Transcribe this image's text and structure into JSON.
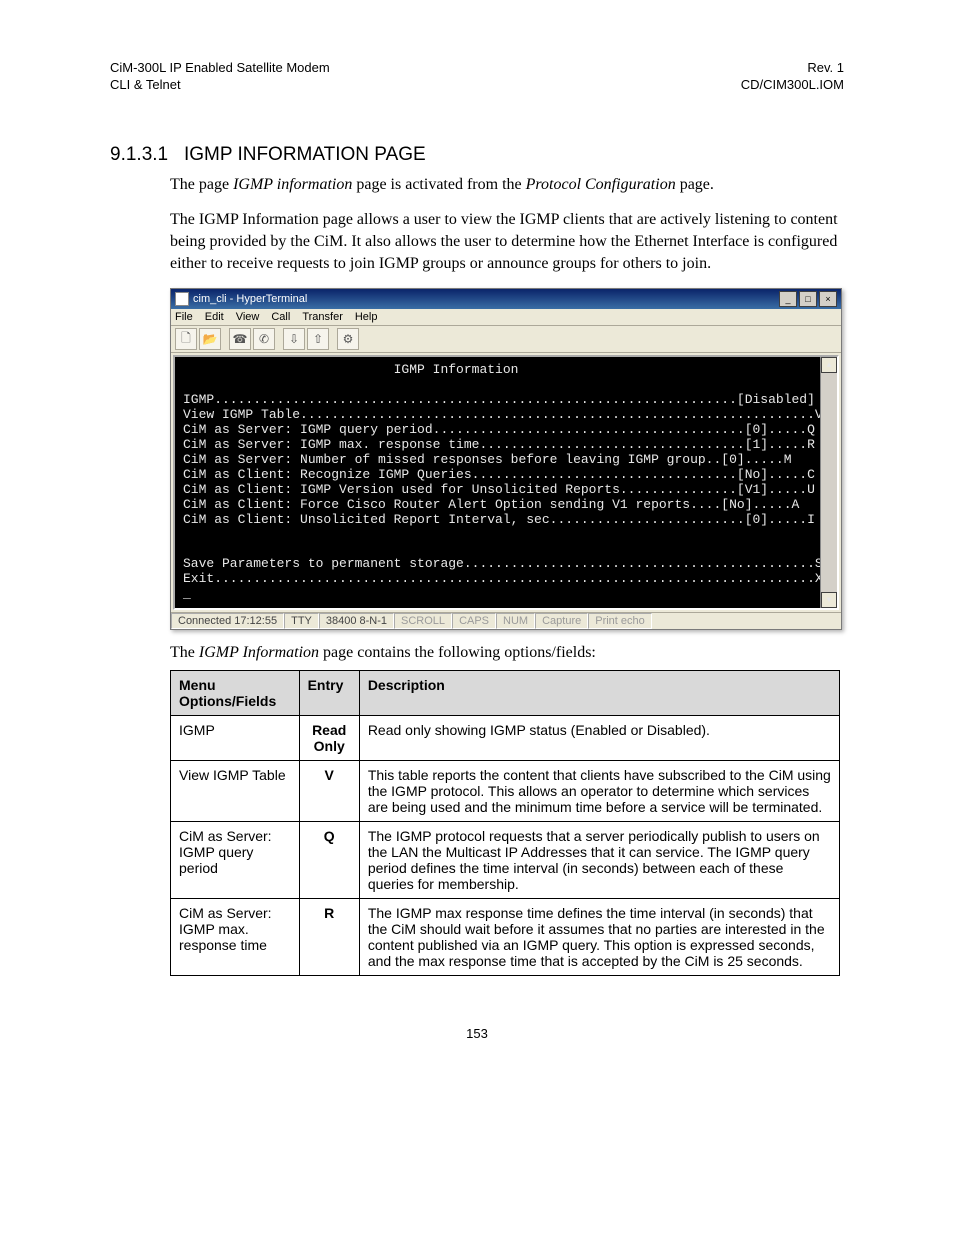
{
  "header": {
    "left1": "CiM-300L IP Enabled Satellite Modem",
    "left2": "CLI & Telnet",
    "right1": "Rev. 1",
    "right2": "CD/CIM300L.IOM"
  },
  "section": {
    "number": "9.1.3.1",
    "title": "IGMP INFORMATION PAGE"
  },
  "para1_pre": "The page ",
  "para1_em1": "IGMP information",
  "para1_mid": " page is activated from the ",
  "para1_em2": "Protocol Configuration",
  "para1_post": " page.",
  "para2": "The IGMP Information page allows a user to view the IGMP clients that are actively listening to content being provided by the CiM. It also allows the user to determine how the Ethernet Interface is configured either to receive requests to join IGMP groups or announce groups for others to join.",
  "ht": {
    "title": "cim_cli - HyperTerminal",
    "menu": [
      "File",
      "Edit",
      "View",
      "Call",
      "Transfer",
      "Help"
    ],
    "term_heading": "IGMP Information",
    "lines": [
      "IGMP...................................................................[Disabled]",
      "View IGMP Table..................................................................V",
      "CiM as Server: IGMP query period........................................[0].....Q",
      "CiM as Server: IGMP max. response time..................................[1].....R",
      "CiM as Server: Number of missed responses before leaving IGMP group..[0].....M",
      "CiM as Client: Recognize IGMP Queries..................................[No].....C",
      "CiM as Client: IGMP Version used for Unsolicited Reports...............[V1].....U",
      "CiM as Client: Force Cisco Router Alert Option sending V1 reports....[No].....A",
      "CiM as Client: Unsolicited Report Interval, sec.........................[0].....I",
      "",
      "",
      "Save Parameters to permanent storage.............................................S",
      "Exit.............................................................................X",
      "_"
    ],
    "status": {
      "connected": "Connected 17:12:55",
      "mode": "TTY",
      "settings": "38400 8-N-1",
      "flags": [
        "SCROLL",
        "CAPS",
        "NUM",
        "Capture",
        "Print echo"
      ]
    }
  },
  "caption_pre": "The ",
  "caption_em": "IGMP Information",
  "caption_post": " page contains the following options/fields:",
  "table": {
    "headers": [
      "Menu Options/Fields",
      "Entry",
      "Description"
    ],
    "rows": [
      {
        "opt": "IGMP",
        "entry": "Read Only",
        "desc": "Read only showing IGMP status (Enabled or Disabled)."
      },
      {
        "opt": "View IGMP Table",
        "entry": "V",
        "desc": "This table reports the content that clients have subscribed to the CiM using the IGMP protocol. This allows an operator to determine which services are being used and the minimum time before a service will be terminated."
      },
      {
        "opt": "CiM as Server:\nIGMP query period",
        "entry": "Q",
        "desc": "The IGMP protocol requests that a server periodically publish to users on the LAN the Multicast IP Addresses that it can service. The IGMP query period defines the time interval (in seconds) between each of these queries for membership."
      },
      {
        "opt": "CiM as Server:\nIGMP max. response time",
        "entry": "R",
        "desc": "The IGMP max response time defines the time interval (in seconds) that the CiM should wait before it assumes that no parties are interested in the content published via an IGMP query. This option is expressed seconds, and the max response time that is accepted by the CiM is 25 seconds."
      }
    ]
  },
  "page_number": "153"
}
